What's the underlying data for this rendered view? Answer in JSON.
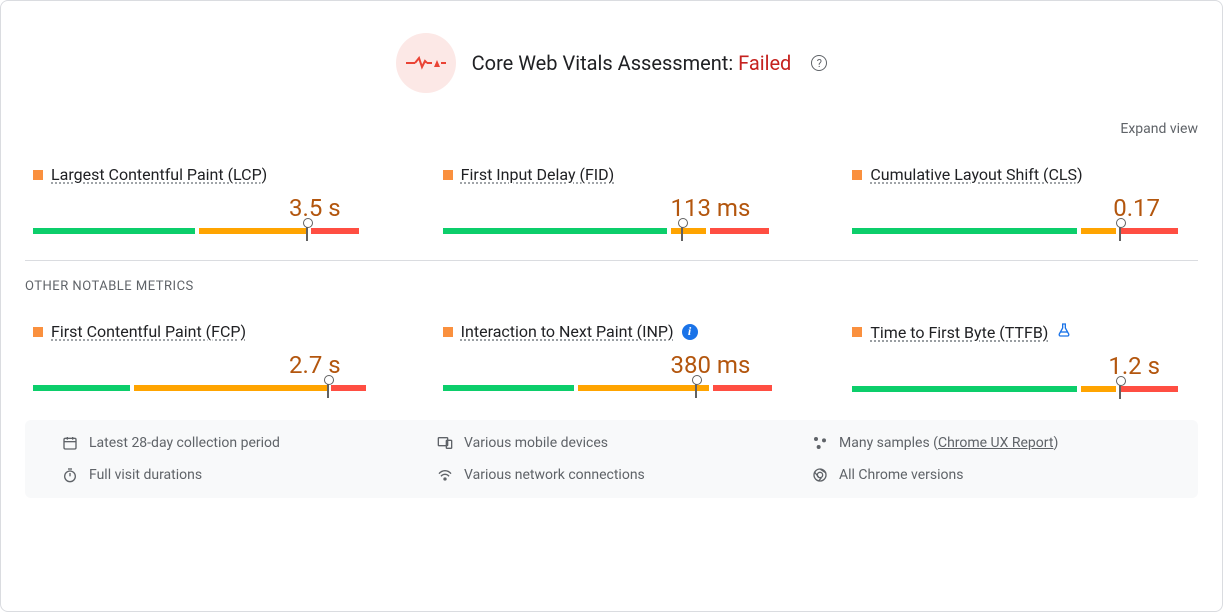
{
  "header": {
    "title_prefix": "Core Web Vitals Assessment: ",
    "status": "Failed"
  },
  "expand_view": "Expand view",
  "core_metrics": [
    {
      "name": "Largest Contentful Paint (LCP)",
      "value": "3.5 s",
      "marker_pct": 79,
      "segs": [
        47,
        31,
        14
      ]
    },
    {
      "name": "First Input Delay (FID)",
      "value": "113 ms",
      "marker_pct": 69,
      "segs": [
        65,
        10,
        17
      ]
    },
    {
      "name": "Cumulative Layout Shift (CLS)",
      "value": "0.17",
      "marker_pct": 77,
      "segs": [
        65,
        10,
        17
      ]
    }
  ],
  "section_label": "OTHER NOTABLE METRICS",
  "other_metrics": [
    {
      "name": "First Contentful Paint (FCP)",
      "value": "2.7 s",
      "marker_pct": 85,
      "segs": [
        28,
        56,
        10
      ],
      "badge": null
    },
    {
      "name": "Interaction to Next Paint (INP)",
      "value": "380 ms",
      "marker_pct": 73,
      "segs": [
        38,
        38,
        17
      ],
      "badge": "info"
    },
    {
      "name": "Time to First Byte (TTFB)",
      "value": "1.2 s",
      "marker_pct": 77,
      "segs": [
        65,
        10,
        17
      ],
      "badge": "flask"
    }
  ],
  "footer": {
    "period": "Latest 28-day collection period",
    "devices": "Various mobile devices",
    "samples_prefix": "Many samples (",
    "samples_link": "Chrome UX Report",
    "samples_suffix": ")",
    "durations": "Full visit durations",
    "network": "Various network connections",
    "versions": "All Chrome versions"
  }
}
